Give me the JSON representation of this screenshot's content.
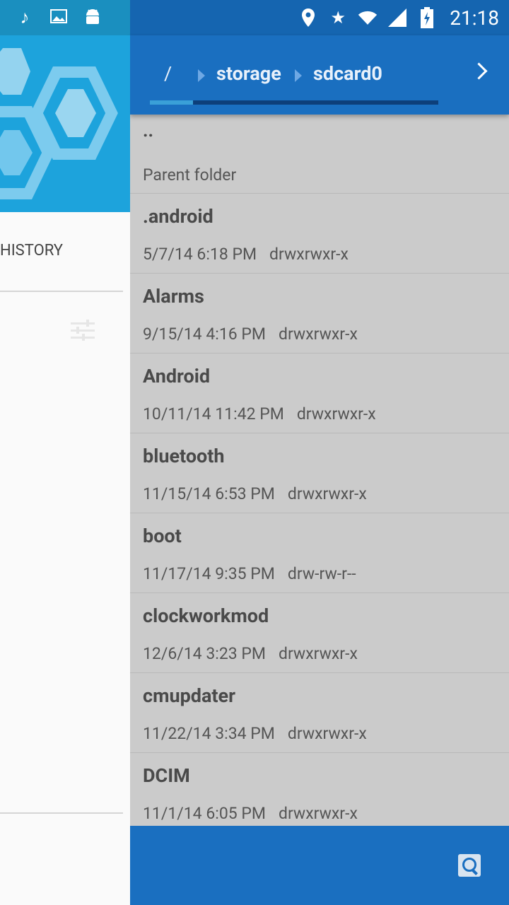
{
  "status": {
    "time": "21:18",
    "left_icons": [
      "music-note-icon",
      "image-icon",
      "android-icon"
    ],
    "right_icons": [
      "location-icon",
      "star-icon",
      "wifi-icon",
      "signal-icon",
      "battery-icon"
    ]
  },
  "breadcrumb": {
    "root": "/",
    "items": [
      "storage",
      "sdcard0"
    ],
    "progress_fraction": 0.15
  },
  "drawer": {
    "history_label": "HISTORY"
  },
  "files": [
    {
      "name": "..",
      "date": "Parent folder",
      "perms": ""
    },
    {
      "name": ".android",
      "date": "5/7/14 6:18 PM",
      "perms": "drwxrwxr-x"
    },
    {
      "name": "Alarms",
      "date": "9/15/14 4:16 PM",
      "perms": "drwxrwxr-x"
    },
    {
      "name": "Android",
      "date": "10/11/14 11:42 PM",
      "perms": "drwxrwxr-x"
    },
    {
      "name": "bluetooth",
      "date": "11/15/14 6:53 PM",
      "perms": "drwxrwxr-x"
    },
    {
      "name": "boot",
      "date": "11/17/14 9:35 PM",
      "perms": "drw-rw-r--"
    },
    {
      "name": "clockworkmod",
      "date": "12/6/14 3:23 PM",
      "perms": "drwxrwxr-x"
    },
    {
      "name": "cmupdater",
      "date": "11/22/14 3:34 PM",
      "perms": "drwxrwxr-x"
    },
    {
      "name": "DCIM",
      "date": "11/1/14 6:05 PM",
      "perms": "drwxrwxr-x"
    }
  ],
  "colors": {
    "appbar": "#1a6fc0",
    "statusbar": "#1565b0",
    "drawer_header": "#1da3dc",
    "list_bg": "#cbcbcb"
  }
}
